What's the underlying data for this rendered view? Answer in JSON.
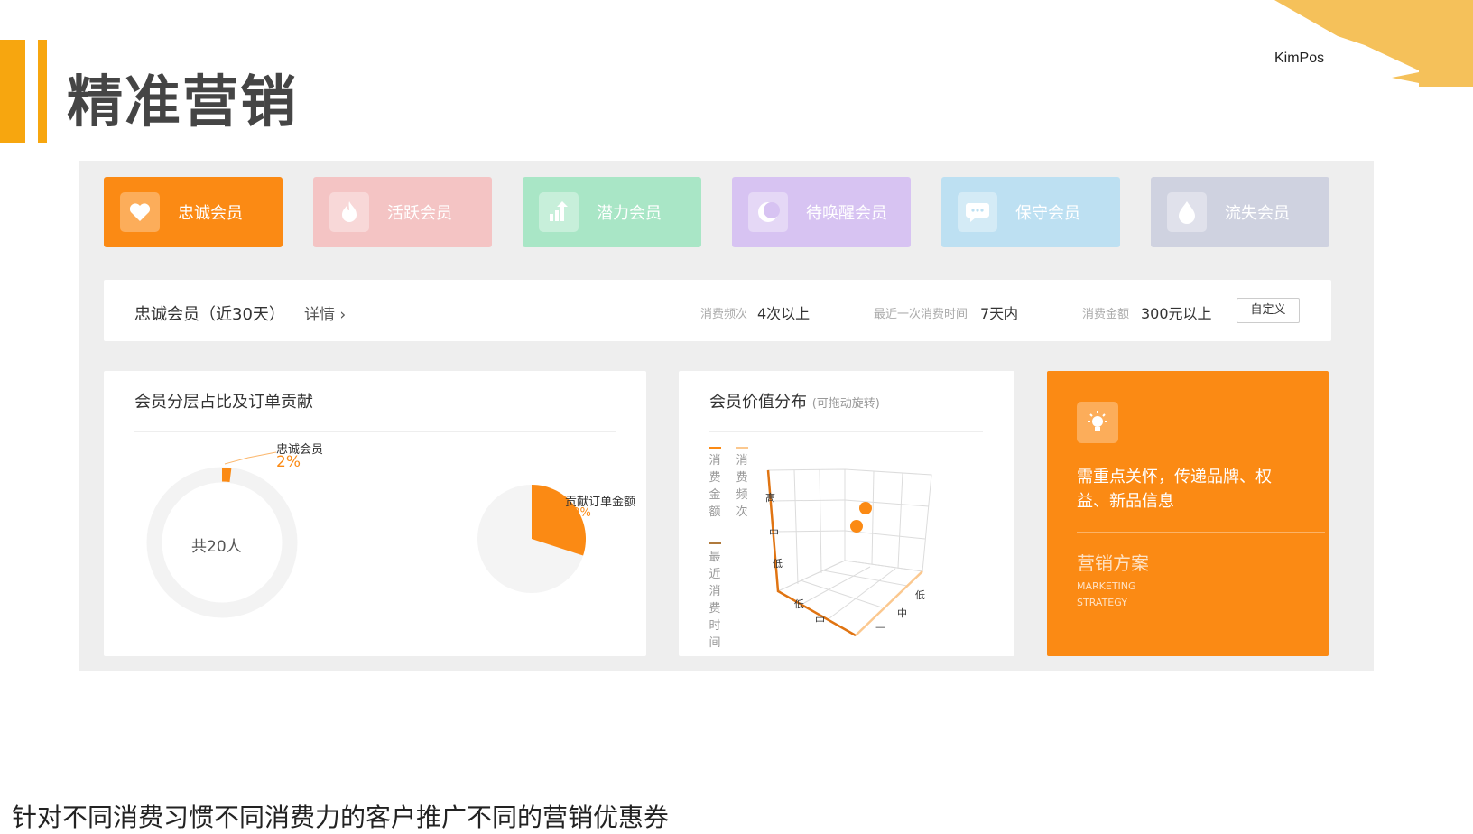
{
  "header": {
    "title": "精准营销",
    "brand": "KimPos"
  },
  "tabs": [
    {
      "label": "忠诚会员",
      "icon": "heart-icon",
      "color": "#fb8a14"
    },
    {
      "label": "活跃会员",
      "icon": "flame-icon",
      "color": "#f4c4c4"
    },
    {
      "label": "潜力会员",
      "icon": "growth-chart-icon",
      "color": "#a9e6c6"
    },
    {
      "label": "待唤醒会员",
      "icon": "moon-icon",
      "color": "#d7c3f2"
    },
    {
      "label": "保守会员",
      "icon": "chat-bubble-icon",
      "color": "#bde0f2"
    },
    {
      "label": "流失会员",
      "icon": "droplet-icon",
      "color": "#cfd2e0"
    }
  ],
  "filter": {
    "title": "忠诚会员（近30天）",
    "detail": "详情 ›",
    "freq_label": "消费频次",
    "freq_value": "4次以上",
    "recent_label": "最近一次消费时间",
    "recent_value": "7天内",
    "amount_label": "消费金额",
    "amount_value": "300元以上",
    "custom_button": "自定义"
  },
  "card1": {
    "title": "会员分层占比及订单贡献",
    "donut_label": "忠诚会员",
    "donut_pct": "2%",
    "donut_center": "共20人",
    "pie_label": "贡献订单金额",
    "pie_pct": "30%",
    "donut_share": 0.02,
    "pie_share": 0.3
  },
  "card2": {
    "title": "会员价值分布",
    "hint": "(可拖动旋转)",
    "legend_amount": "消费金额",
    "legend_freq": "消费频次",
    "legend_recent": "最近消费时间",
    "axis_high": "高",
    "axis_mid": "中",
    "axis_low": "低",
    "axis_dash": "—"
  },
  "card3": {
    "text": "需重点关怀，传递品牌、权益、新品信息",
    "section": "营销方案",
    "en1": "MARKETING",
    "en2": "STRATEGY",
    "icon": "lightbulb-icon"
  },
  "caption": "针对不同消费习惯不同消费力的客户推广不同的营销优惠券",
  "colors": {
    "accent": "#fb8a14",
    "gold": "#f7a60f"
  }
}
